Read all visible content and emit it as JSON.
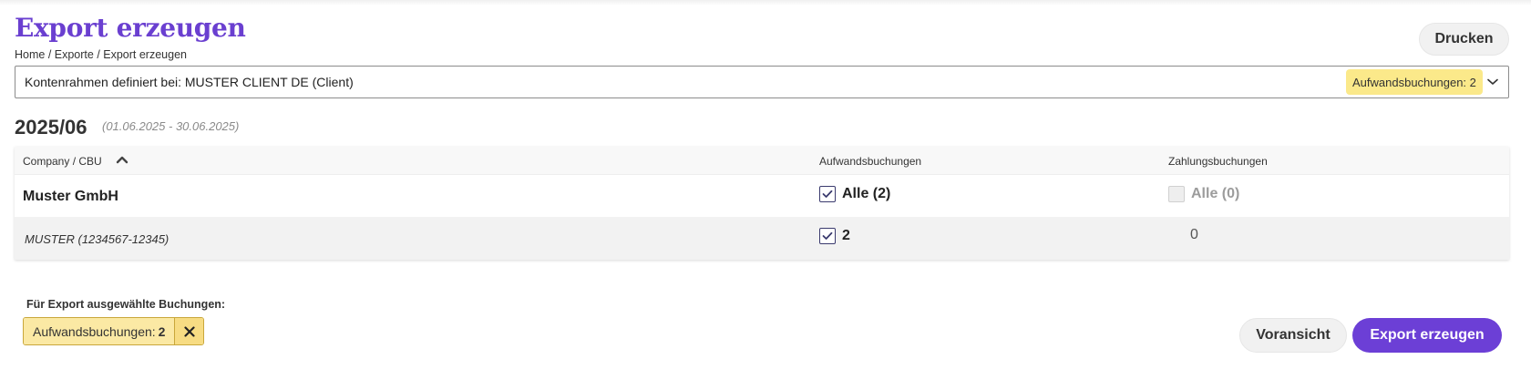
{
  "header": {
    "title": "Export erzeugen",
    "breadcrumb": "Home / Exporte / Export erzeugen",
    "print_label": "Drucken"
  },
  "account_select": {
    "value": "Kontenrahmen definiert bei: MUSTER CLIENT DE (Client)",
    "badge": "Aufwandsbuchungen: 2",
    "icon": "chevron-down-icon"
  },
  "period": {
    "label": "2025/06",
    "range": "(01.06.2025 - 30.06.2025)"
  },
  "table": {
    "columns": [
      "Company / CBU",
      "Aufwandsbuchungen",
      "Zahlungsbuchungen"
    ],
    "sort_icon": "chevron-up-icon",
    "rows": [
      {
        "name": "Muster GmbH",
        "expense": {
          "checked": true,
          "label": "Alle (2)"
        },
        "payment": {
          "checked": false,
          "disabled": true,
          "label": "Alle (0)"
        }
      },
      {
        "name": "MUSTER (1234567-12345)",
        "expense": {
          "checked": true,
          "label": "2"
        },
        "payment": {
          "label": "0"
        }
      }
    ]
  },
  "selection": {
    "heading": "Für Export ausgewählte Buchungen:",
    "chip_label": "Aufwandsbuchungen:",
    "chip_count": "2",
    "chip_icon": "close-icon"
  },
  "footer": {
    "preview_label": "Voransicht",
    "export_label": "Export erzeugen"
  },
  "colors": {
    "accent": "#6c3fd6",
    "title": "#6a3fd0",
    "badge": "#fbe98a"
  }
}
